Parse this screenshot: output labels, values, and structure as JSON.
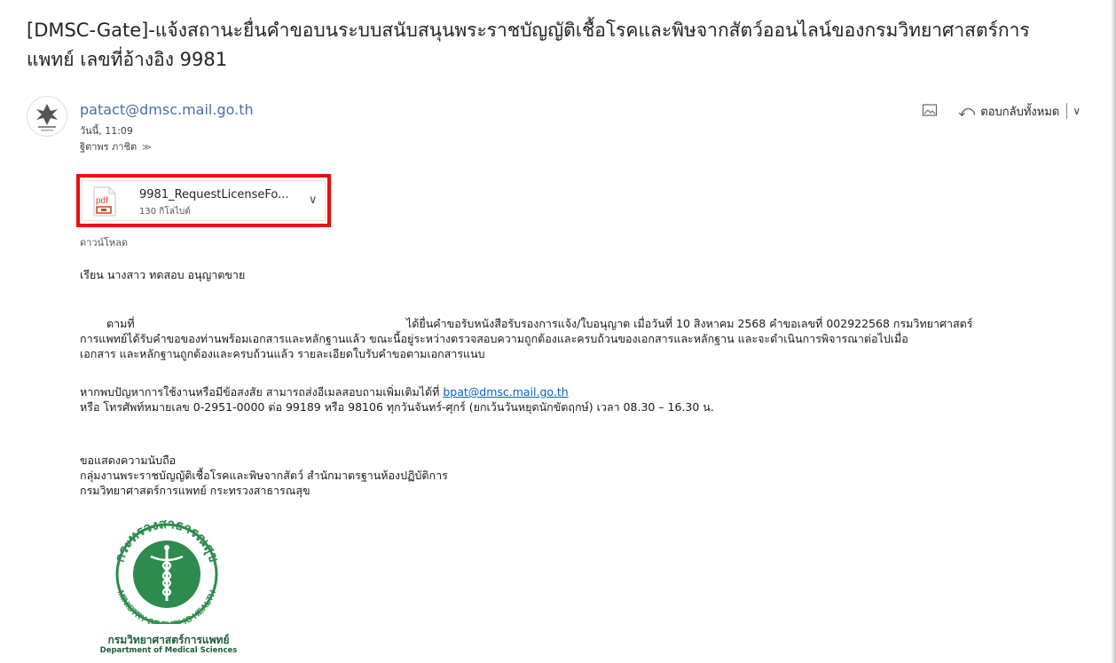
{
  "email": {
    "subject": "[DMSC-Gate]-แจ้งสถานะยื่นคำขอบนระบบสนับสนุนพระราชบัญญัติเชื้อโรคและพิษจากสัตว์ออนไลน์ของกรมวิทยาศาสตร์การแพทย์ เลขที่อ้างอิง 9981",
    "sender": "patact@dmsc.mail.go.th",
    "date": "วันนี้, 11:09",
    "to": "ฐิตาพร ภาชิต"
  },
  "toolbar": {
    "reply_all_label": "ตอบกลับทั้งหมด"
  },
  "attachment": {
    "filename": "9981_RequestLicenseFo...",
    "size": "130 กิโลไบต์",
    "icon_label": "pdf",
    "download_label": "ดาวน์โหลด"
  },
  "body": {
    "greeting": "เรียน นางสาว ทดสอบ อนุญาตขาย",
    "p1_line1_start": "ตามที่",
    "p1_line1_end": "ได้ยื่นคำขอรับหนังสือรับรองการแจ้ง/ใบอนุญาต เมื่อวันที่ 10 สิงหาคม 2568 คำขอเลขที่ 002922568 กรมวิทยาศาสตร์",
    "p1_line2": "การแพทย์ได้รับคำขอของท่านพร้อมเอกสารและหลักฐานแล้ว ขณะนี้อยู่ระหว่างตรวจสอบความถูกต้องและครบถ้วนของเอกสารและหลักฐาน และจะดำเนินการพิจารณาต่อไปเมื่อ",
    "p1_line3": "เอกสาร และหลักฐานถูกต้องและครบถ้วนแล้ว รายละเอียดใบรับคำขอตามเอกสารแนบ",
    "p2_line1_prefix": "หากพบปัญหาการใช้งานหรือมีข้อสงสัย สามารถส่งอีเมลสอบถามเพิ่มเติมได้ที่",
    "p2_link": "bpat@dmsc.mail.go.th",
    "p2_line2": "หรือ โทรศัพท์หมายเลข 0-2951-0000 ต่อ 99189 หรือ 98106 ทุกวันจันทร์-ศุกร์ (ยกเว้นวันหยุดนักขัตฤกษ์) เวลา 08.30 – 16.30 น.",
    "closing": "ขอแสดงความนับถือ",
    "sig_line1": "กลุ่มงานพระราชบัญญัติเชื้อโรคและพิษจากสัตว์ สำนักมาตรฐานห้องปฏิบัติการ",
    "sig_line2": "กรมวิทยาศาสตร์การแพทย์ กระทรวงสาธารณสุข"
  },
  "logo": {
    "ring_text_th": "กระทรวงสาธารณสุข",
    "ring_text_en": "MINISTRY OF PUBLIC HEALTH",
    "caption_th": "กรมวิทยาศาสตร์การแพทย์",
    "caption_en": "Department of Medical Sciences",
    "color": "#2e8b4e"
  },
  "colors": {
    "highlight": "#e81010",
    "link": "#0563c1",
    "sender": "#4a6fa5"
  }
}
